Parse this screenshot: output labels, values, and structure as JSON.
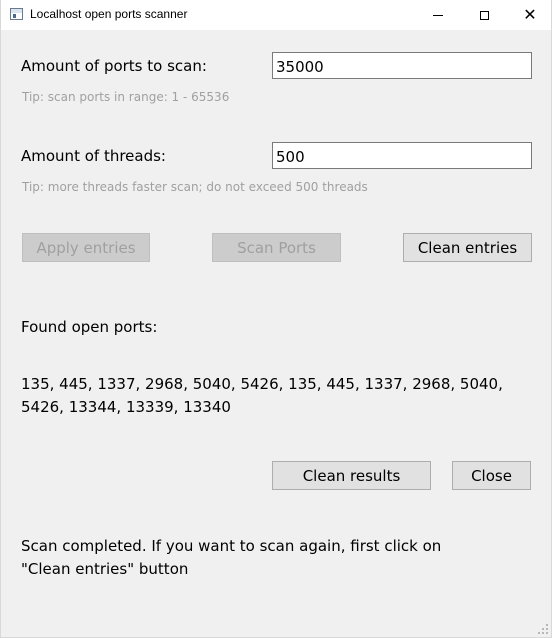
{
  "window": {
    "title": "Localhost open ports scanner",
    "controls": {
      "minimize_icon": "minimize-icon",
      "maximize_icon": "maximize-icon",
      "close_icon": "close-icon",
      "close_glyph": "✕"
    }
  },
  "ports": {
    "label": "Amount of ports to scan:",
    "value": "35000",
    "tip": "Tip: scan ports in range: 1 - 65536"
  },
  "threads": {
    "label": "Amount of threads:",
    "value": "500",
    "tip": "Tip: more threads faster scan; do not exceed 500 threads"
  },
  "buttons": {
    "apply": "Apply entries",
    "scan": "Scan Ports",
    "clean_entries": "Clean entries",
    "clean_results": "Clean results",
    "close": "Close"
  },
  "results": {
    "label": "Found open ports:",
    "ports_line1": "135, 445, 1337, 2968, 5040, 5426, 135, 445, 1337, 2968, 5040,",
    "ports_line2": "5426, 13344, 13339, 13340"
  },
  "status": {
    "line1": "Scan completed. If you want to scan again, first click on",
    "line2": "\"Clean entries\" button"
  },
  "colors": {
    "background": "#f0f0f0",
    "tip_text": "#a0a0a0",
    "disabled_text": "#a0a0a0",
    "button_face": "#e1e1e1"
  }
}
